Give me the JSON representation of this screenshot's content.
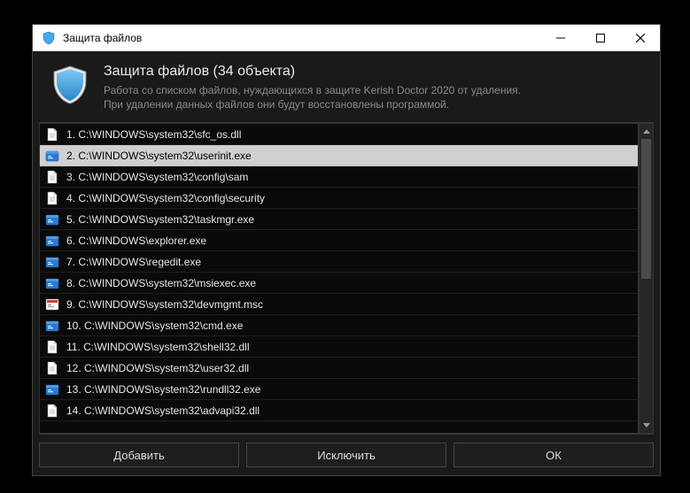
{
  "window": {
    "title": "Защита файлов"
  },
  "header": {
    "heading": "Защита файлов (34 объекта)",
    "line1": "Работа со списком файлов, нуждающихся в защите Kerish Doctor 2020 от удаления.",
    "line2": "При удалении данных файлов они будут восстановлены программой."
  },
  "rows": [
    {
      "n": 1,
      "icon": "file",
      "path": "C:\\WINDOWS\\system32\\sfc_os.dll"
    },
    {
      "n": 2,
      "icon": "exe",
      "path": "C:\\WINDOWS\\system32\\userinit.exe",
      "selected": true
    },
    {
      "n": 3,
      "icon": "file",
      "path": "C:\\WINDOWS\\system32\\config\\sam"
    },
    {
      "n": 4,
      "icon": "file",
      "path": "C:\\WINDOWS\\system32\\config\\security"
    },
    {
      "n": 5,
      "icon": "exe",
      "path": "C:\\WINDOWS\\system32\\taskmgr.exe"
    },
    {
      "n": 6,
      "icon": "exe",
      "path": "C:\\WINDOWS\\explorer.exe"
    },
    {
      "n": 7,
      "icon": "exe",
      "path": "C:\\WINDOWS\\regedit.exe"
    },
    {
      "n": 8,
      "icon": "exe",
      "path": "C:\\WINDOWS\\system32\\msiexec.exe"
    },
    {
      "n": 9,
      "icon": "msc",
      "path": "C:\\WINDOWS\\system32\\devmgmt.msc"
    },
    {
      "n": 10,
      "icon": "exe",
      "path": "C:\\WINDOWS\\system32\\cmd.exe"
    },
    {
      "n": 11,
      "icon": "file",
      "path": "C:\\WINDOWS\\system32\\shell32.dll"
    },
    {
      "n": 12,
      "icon": "file",
      "path": "C:\\WINDOWS\\system32\\user32.dll"
    },
    {
      "n": 13,
      "icon": "exe",
      "path": "C:\\WINDOWS\\system32\\rundll32.exe"
    },
    {
      "n": 14,
      "icon": "file",
      "path": "C:\\WINDOWS\\system32\\advapi32.dll"
    }
  ],
  "buttons": {
    "add": "Добавить",
    "exclude": "Исключить",
    "ok": "ОК"
  }
}
